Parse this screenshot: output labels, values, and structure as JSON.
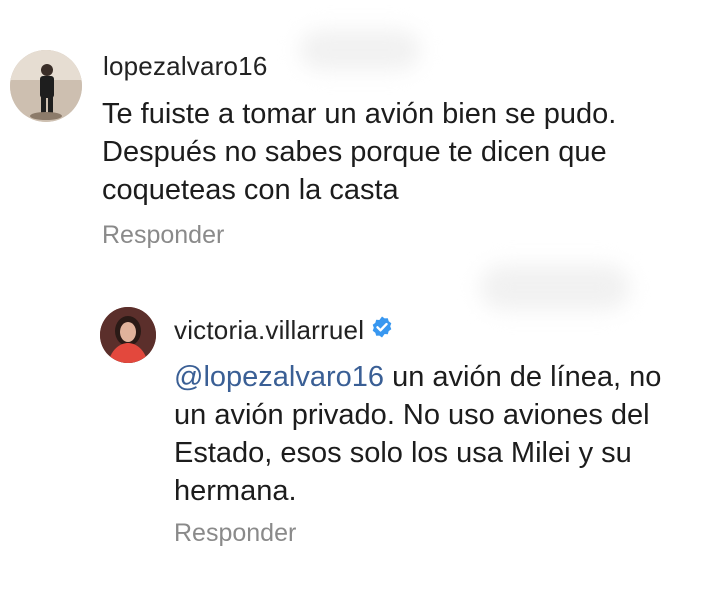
{
  "comments": [
    {
      "username": "lopezalvaro16",
      "lines": [
        "Te fuiste a tomar un avión bien se pudo.",
        "Después no sabes porque te dicen que",
        "coqueteas con la casta"
      ],
      "reply_label": "Responder",
      "avatar_icon": "user-photo-avatar"
    },
    {
      "username": "victoria.villarruel",
      "verified": true,
      "verified_icon": "verified-badge-icon",
      "mention": "@lopezalvaro16",
      "line1_rest": " un avión de línea, no",
      "lines": [
        "un avión privado. No uso aviones del",
        "Estado, esos solo los usa Milei y su",
        "hermana."
      ],
      "reply_label": "Responder",
      "avatar_icon": "user-photo-avatar",
      "accent_color": "#3a5f95",
      "badge_color": "#3897f0"
    }
  ]
}
